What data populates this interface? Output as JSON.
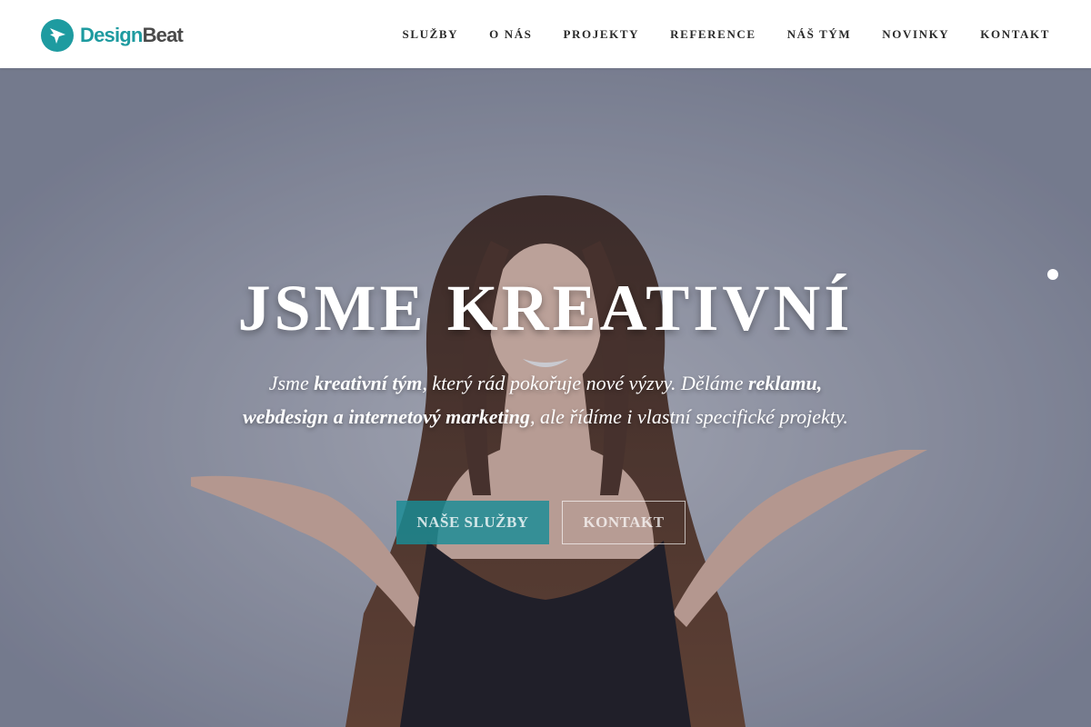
{
  "header": {
    "logo": {
      "word_part1": "Design",
      "word_part2": "Beat",
      "icon": "logo-bird-icon",
      "color_primary": "#1e9ba0",
      "color_secondary": "#4a4a4a"
    },
    "nav": [
      {
        "label": "SLUŽBY"
      },
      {
        "label": "O NÁS"
      },
      {
        "label": "PROJEKTY"
      },
      {
        "label": "REFERENCE"
      },
      {
        "label": "NÁŠ TÝM"
      },
      {
        "label": "NOVINKY"
      },
      {
        "label": "KONTAKT"
      }
    ]
  },
  "hero": {
    "title": "JSME KREATIVNÍ",
    "lead": {
      "t1": "Jsme ",
      "b1": "kreativní tým",
      "t2": ", který rád pokořuje nové výzvy. Děláme ",
      "b2": "reklamu, webdesign a internetový marketing",
      "t3": ", ale řídíme i vlastní specifické projekty."
    },
    "primary_button": "NAŠE SLUŽBY",
    "secondary_button": "KONTAKT",
    "slider": {
      "dots": 1,
      "active": 1
    },
    "accent_color": "#1e9ba0"
  }
}
